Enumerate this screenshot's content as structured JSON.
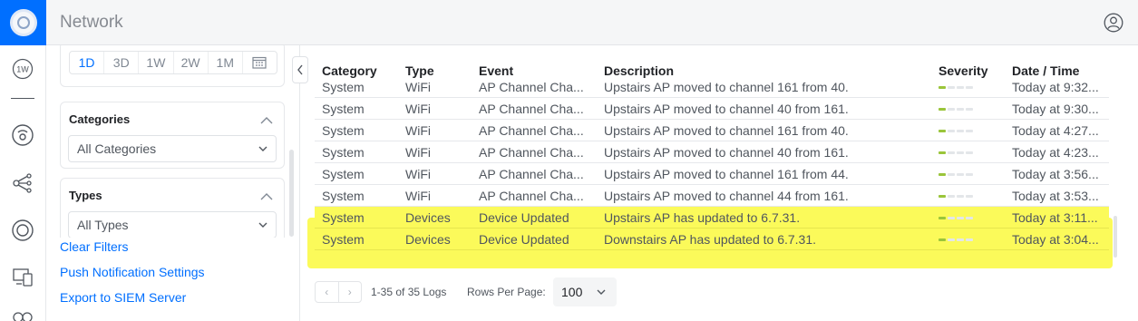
{
  "app": {
    "title": "Network"
  },
  "sidebar": {
    "icons": [
      "unifi-logo-icon",
      "wifi-experience-icon",
      "gateway-icon",
      "topology-icon",
      "unifi-devices-icon",
      "client-devices-icon",
      "insights-icon"
    ],
    "badge": "1W"
  },
  "filters": {
    "ranges": [
      "1D",
      "3D",
      "1W",
      "2W",
      "1M"
    ],
    "active_range": "1D",
    "categories": {
      "title": "Categories",
      "value": "All Categories"
    },
    "types": {
      "title": "Types",
      "value": "All Types"
    },
    "links": {
      "clear": "Clear Filters",
      "push": "Push Notification Settings",
      "siem": "Export to SIEM Server"
    }
  },
  "table": {
    "columns": [
      "Category",
      "Type",
      "Event",
      "Description",
      "Severity",
      "Date / Time"
    ],
    "rows": [
      {
        "category": "System",
        "type": "WiFi",
        "event": "AP Channel Cha...",
        "description": "Upstairs AP moved to channel 161 from 40.",
        "severity": 1,
        "time": "Today at 9:32...",
        "highlighted": false
      },
      {
        "category": "System",
        "type": "WiFi",
        "event": "AP Channel Cha...",
        "description": "Upstairs AP moved to channel 40 from 161.",
        "severity": 1,
        "time": "Today at 9:30...",
        "highlighted": false
      },
      {
        "category": "System",
        "type": "WiFi",
        "event": "AP Channel Cha...",
        "description": "Upstairs AP moved to channel 161 from 40.",
        "severity": 1,
        "time": "Today at 4:27...",
        "highlighted": false
      },
      {
        "category": "System",
        "type": "WiFi",
        "event": "AP Channel Cha...",
        "description": "Upstairs AP moved to channel 40 from 161.",
        "severity": 1,
        "time": "Today at 4:23...",
        "highlighted": false
      },
      {
        "category": "System",
        "type": "WiFi",
        "event": "AP Channel Cha...",
        "description": "Upstairs AP moved to channel 161 from 44.",
        "severity": 1,
        "time": "Today at 3:56...",
        "highlighted": false
      },
      {
        "category": "System",
        "type": "WiFi",
        "event": "AP Channel Cha...",
        "description": "Upstairs AP moved to channel 44 from 161.",
        "severity": 1,
        "time": "Today at 3:53...",
        "highlighted": false
      },
      {
        "category": "System",
        "type": "Devices",
        "event": "Device Updated",
        "description": "Upstairs AP has updated to 6.7.31.",
        "severity": 1,
        "time": "Today at 3:11...",
        "highlighted": true
      },
      {
        "category": "System",
        "type": "Devices",
        "event": "Device Updated",
        "description": "Downstairs AP has updated to 6.7.31.",
        "severity": 1,
        "time": "Today at 3:04...",
        "highlighted": true
      }
    ]
  },
  "pagination": {
    "prev": "‹",
    "next": "›",
    "count": "1-35 of 35 Logs",
    "rows_per_page_label": "Rows Per Page:",
    "rows_per_page": "100"
  },
  "colors": {
    "accent": "#006fff",
    "highlight": "#fbfa5a",
    "severity_on": "#9ac53a"
  }
}
